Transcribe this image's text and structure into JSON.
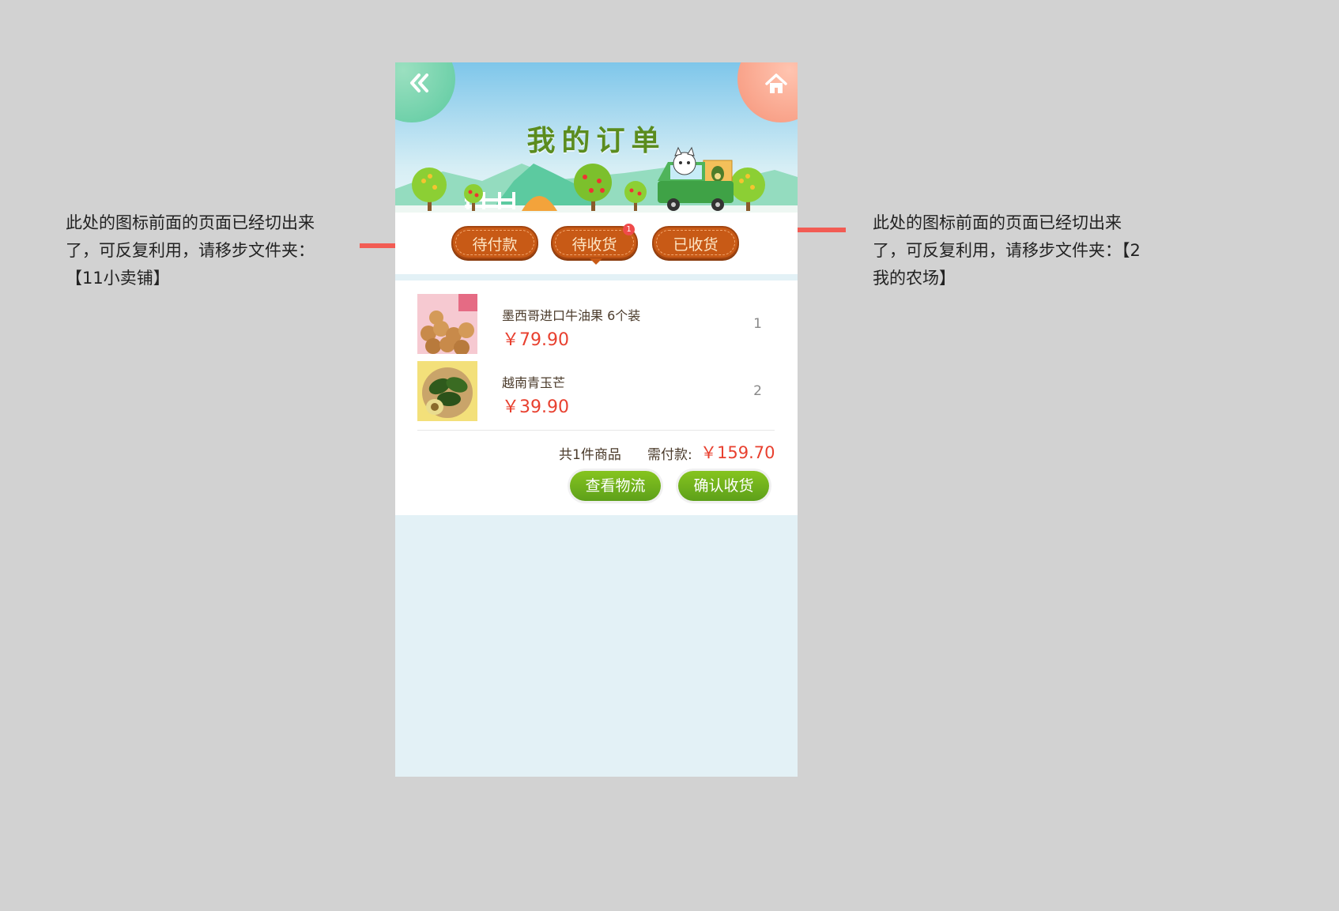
{
  "annotations": {
    "left_note": "此处的图标前面的页面已经切出来了，可反复利用，请移步文件夹：【11小卖铺】",
    "right_note": "此处的图标前面的页面已经切出来了，可反复利用，请移步文件夹：【2我的农场】"
  },
  "header": {
    "title": "我的订单",
    "back_icon": "double-chevron-left-icon",
    "home_icon": "home-icon"
  },
  "tabs": [
    {
      "label": "待付款",
      "active": false
    },
    {
      "label": "待收货",
      "active": true,
      "badge": "1"
    },
    {
      "label": "已收货",
      "active": false
    }
  ],
  "order": {
    "items": [
      {
        "name": "墨西哥进口牛油果 6个装",
        "price": "￥79.90",
        "qty": "1"
      },
      {
        "name": "越南青玉芒",
        "price": "￥39.90",
        "qty": "2"
      }
    ],
    "summary_count": "共1件商品",
    "summary_due_label": "需付款:",
    "summary_total": "￥159.70",
    "buttons": {
      "view_logistics": "查看物流",
      "confirm_receipt": "确认收货"
    }
  },
  "colors": {
    "page_bg": "#d2d2d2",
    "tab_brown": "#c85a16",
    "price_red": "#e8402f",
    "button_green": "#6fb11c",
    "arrow_red": "#f25c54"
  }
}
